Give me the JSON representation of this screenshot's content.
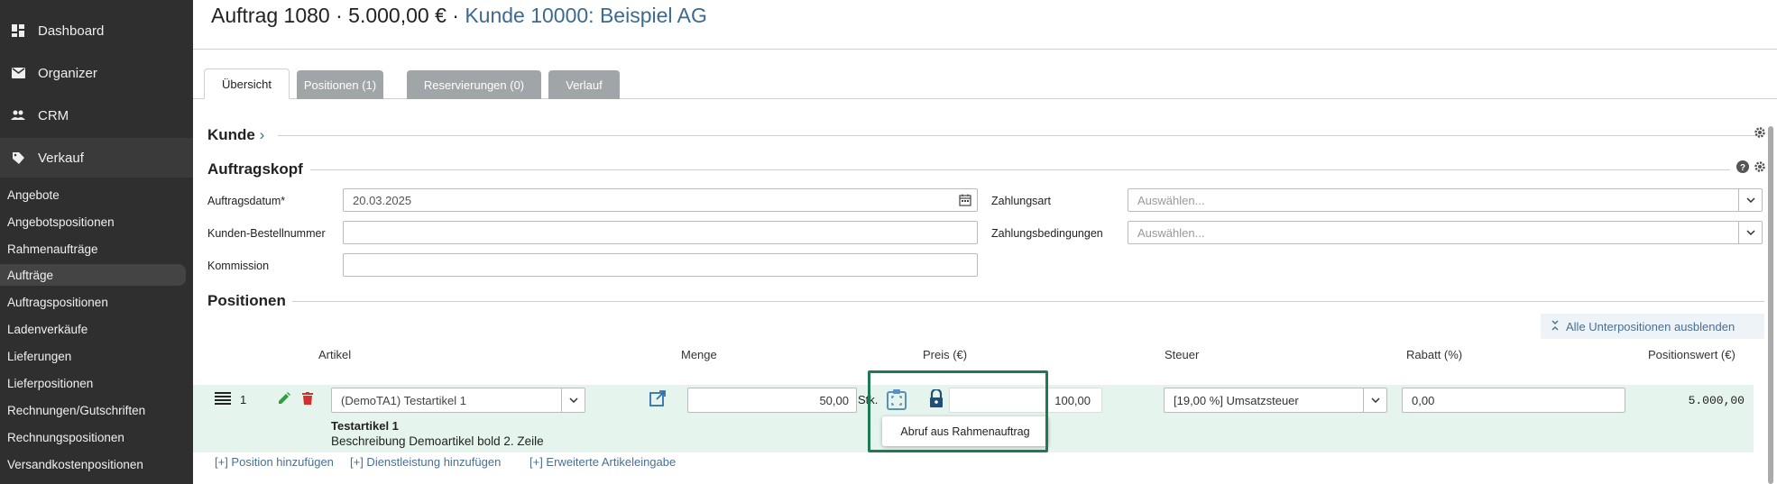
{
  "sidebar": {
    "top_items": [
      {
        "label": "Dashboard",
        "icon": "dashboard-icon"
      },
      {
        "label": "Organizer",
        "icon": "mail-icon"
      },
      {
        "label": "CRM",
        "icon": "people-icon"
      },
      {
        "label": "Verkauf",
        "icon": "tag-icon"
      }
    ],
    "sub_items": [
      {
        "label": "Angebote"
      },
      {
        "label": "Angebotspositionen"
      },
      {
        "label": "Rahmenaufträge"
      },
      {
        "label": "Aufträge"
      },
      {
        "label": "Auftragspositionen"
      },
      {
        "label": "Ladenverkäufe"
      },
      {
        "label": "Lieferungen"
      },
      {
        "label": "Lieferpositionen"
      },
      {
        "label": "Rechnungen/Gutschriften"
      },
      {
        "label": "Rechnungspositionen"
      },
      {
        "label": "Versandkostenpositionen"
      }
    ]
  },
  "header": {
    "title_prefix": "Auftrag 1080 · 5.000,00 € · ",
    "customer_link": "Kunde 10000: Beispiel AG"
  },
  "tabs": [
    {
      "label": "Übersicht"
    },
    {
      "label": "Positionen (1)"
    },
    {
      "label": "Reservierungen (0)"
    },
    {
      "label": "Verlauf"
    }
  ],
  "sections": {
    "kunde": "Kunde",
    "kunde_chevron": "›",
    "auftragskopf": "Auftragskopf",
    "positionen": "Positionen"
  },
  "form": {
    "auftragsdatum_label": "Auftragsdatum*",
    "auftragsdatum_value": "20.03.2025",
    "bestellnummer_label": "Kunden-Bestellnummer",
    "kommission_label": "Kommission",
    "zahlungsart_label": "Zahlungsart",
    "zahlungsart_placeholder": "Auswählen...",
    "zahlungsbedingungen_label": "Zahlungsbedingungen",
    "zahlungsbedingungen_placeholder": "Auswählen..."
  },
  "positions": {
    "toggle_label": "Alle Unterpositionen ausblenden",
    "columns": {
      "artikel": "Artikel",
      "menge": "Menge",
      "preis": "Preis (€)",
      "steuer": "Steuer",
      "rabatt": "Rabatt (%)",
      "positionswert": "Positionswert (€)"
    },
    "row": {
      "number": "1",
      "artikel": "(DemoTA1) Testartikel 1",
      "menge": "50,00",
      "unit": "Stk.",
      "preis": "100,00",
      "steuer": "[19,00 %] Umsatzsteuer",
      "rabatt": "0,00",
      "positionswert": "5.000,00",
      "article_name": "Testartikel 1",
      "article_desc": "Beschreibung Demoartikel bold 2. Zeile"
    },
    "tooltip": "Abruf aus Rahmenauftrag",
    "links": [
      "[+] Position hinzufügen",
      "[+] Dienstleistung hinzufügen",
      "[+] Erweiterte Artikeleingabe"
    ]
  },
  "colors": {
    "sidebar_bg": "#2f2f2f",
    "link": "#3d6a8f",
    "row_bg": "#e6f4ee",
    "highlight": "#1f7a54",
    "edit_green": "#2e9e3e",
    "delete_red": "#d32f2f",
    "blue_icon": "#2f6fae"
  }
}
